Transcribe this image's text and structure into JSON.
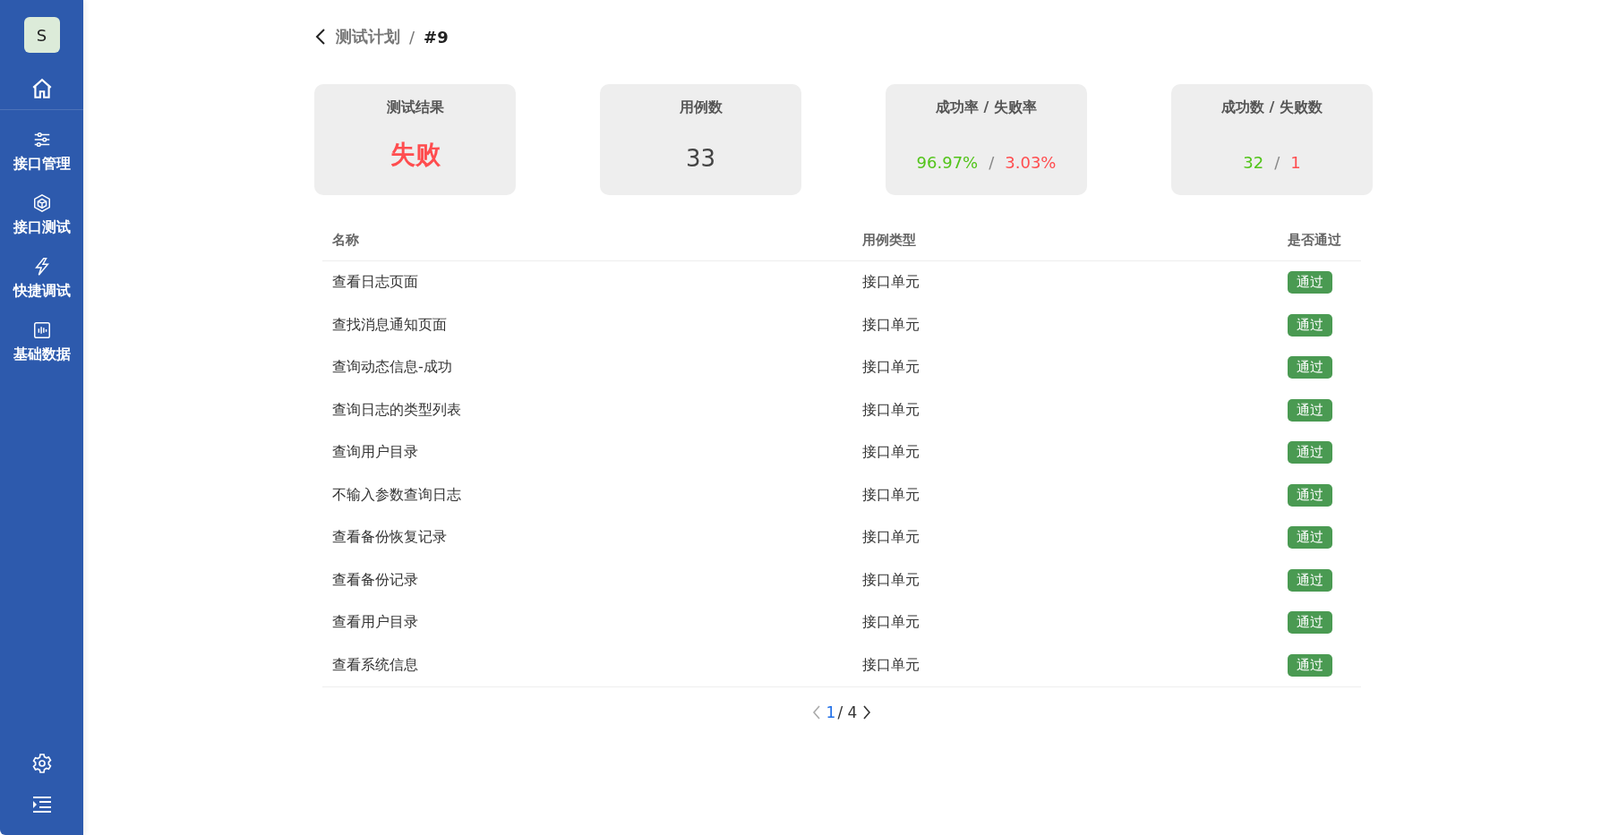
{
  "sidebar": {
    "avatar": "S",
    "items": [
      {
        "kind": "home"
      },
      {
        "kind": "sliders",
        "label": "接口管理"
      },
      {
        "kind": "cube",
        "label": "接口测试"
      },
      {
        "kind": "bolt",
        "label": "快捷调试"
      },
      {
        "kind": "chart",
        "label": "基础数据"
      }
    ],
    "bottom": [
      {
        "kind": "gear"
      },
      {
        "kind": "menu"
      }
    ]
  },
  "breadcrumb": {
    "parent": "测试计划",
    "separator": "/",
    "current": "#9"
  },
  "stats": [
    {
      "title": "测试结果",
      "kind": "result",
      "value": "失败",
      "failed": true
    },
    {
      "title": "用例数",
      "kind": "plain",
      "value": "33"
    },
    {
      "title": "成功率 / 失败率",
      "kind": "pair",
      "good": "96.97%",
      "separator": "/",
      "bad": "3.03%"
    },
    {
      "title": "成功数 / 失败数",
      "kind": "pair",
      "good": "32",
      "separator": "/",
      "bad": "1"
    }
  ],
  "table": {
    "columns": [
      "名称",
      "用例类型",
      "是否通过"
    ],
    "rows": [
      {
        "name": "查看日志页面",
        "type": "接口单元",
        "status": "通过",
        "passed": true
      },
      {
        "name": "查找消息通知页面",
        "type": "接口单元",
        "status": "通过",
        "passed": true
      },
      {
        "name": "查询动态信息-成功",
        "type": "接口单元",
        "status": "通过",
        "passed": true
      },
      {
        "name": "查询日志的类型列表",
        "type": "接口单元",
        "status": "通过",
        "passed": true
      },
      {
        "name": "查询用户目录",
        "type": "接口单元",
        "status": "通过",
        "passed": true
      },
      {
        "name": "不输入参数查询日志",
        "type": "接口单元",
        "status": "通过",
        "passed": true
      },
      {
        "name": "查看备份恢复记录",
        "type": "接口单元",
        "status": "通过",
        "passed": true
      },
      {
        "name": "查看备份记录",
        "type": "接口单元",
        "status": "通过",
        "passed": true
      },
      {
        "name": "查看用户目录",
        "type": "接口单元",
        "status": "通过",
        "passed": true
      },
      {
        "name": "查看系统信息",
        "type": "接口单元",
        "status": "通过",
        "passed": true
      }
    ]
  },
  "pagination": {
    "current": "1",
    "total": "/ 4",
    "prev_disabled": true,
    "next_disabled": false
  }
}
